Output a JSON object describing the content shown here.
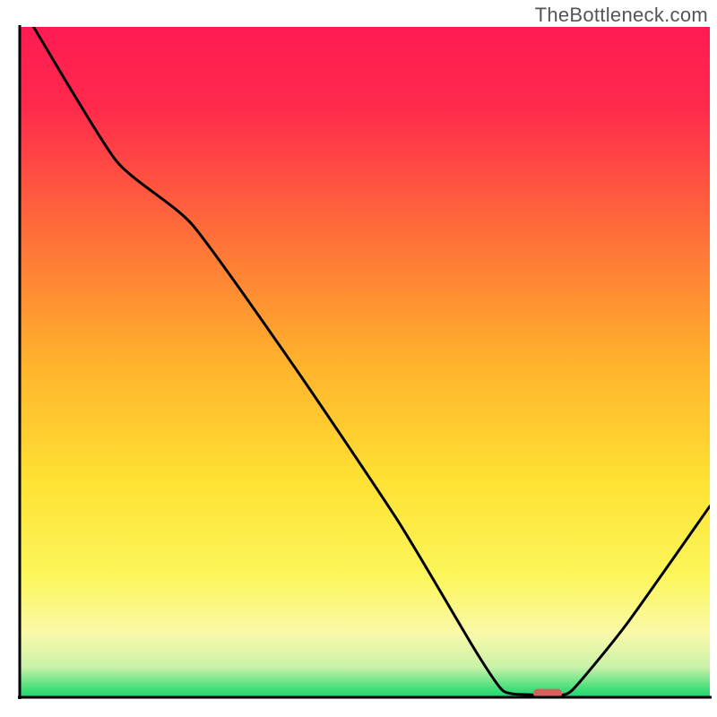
{
  "watermark": "TheBottleneck.com",
  "chart_data": {
    "type": "line",
    "title": "",
    "xlabel": "",
    "ylabel": "",
    "xlim": [
      0,
      100
    ],
    "ylim": [
      0,
      100
    ],
    "background_gradient": {
      "stops": [
        {
          "offset": 0.0,
          "color": "#ff1b52"
        },
        {
          "offset": 0.12,
          "color": "#ff2a4c"
        },
        {
          "offset": 0.3,
          "color": "#ff6b3a"
        },
        {
          "offset": 0.5,
          "color": "#ffb22c"
        },
        {
          "offset": 0.68,
          "color": "#ffe233"
        },
        {
          "offset": 0.82,
          "color": "#fbf65b"
        },
        {
          "offset": 0.905,
          "color": "#faf9a9"
        },
        {
          "offset": 0.955,
          "color": "#c9f2a8"
        },
        {
          "offset": 0.985,
          "color": "#4de07c"
        },
        {
          "offset": 1.0,
          "color": "#1ad66e"
        }
      ]
    },
    "series": [
      {
        "name": "curve",
        "comment": "x,y values in chart units (0-100 each); y=0 at bottom, y=100 at top",
        "points": [
          {
            "x": 2.0,
            "y": 100.0
          },
          {
            "x": 14.0,
            "y": 80.0
          },
          {
            "x": 25.0,
            "y": 70.5
          },
          {
            "x": 40.0,
            "y": 49.0
          },
          {
            "x": 55.0,
            "y": 26.0
          },
          {
            "x": 66.0,
            "y": 7.0
          },
          {
            "x": 70.0,
            "y": 1.0
          },
          {
            "x": 73.5,
            "y": 0.4
          },
          {
            "x": 77.0,
            "y": 0.4
          },
          {
            "x": 80.0,
            "y": 1.0
          },
          {
            "x": 88.0,
            "y": 11.0
          },
          {
            "x": 100.0,
            "y": 28.5
          }
        ]
      }
    ],
    "marker": {
      "comment": "small rounded marker near the minimum on the baseline",
      "x": 76.5,
      "y": 0.6,
      "width": 4.2,
      "height": 1.3,
      "color": "#d6605d"
    },
    "axes": {
      "color": "#000000",
      "width": 3
    }
  }
}
